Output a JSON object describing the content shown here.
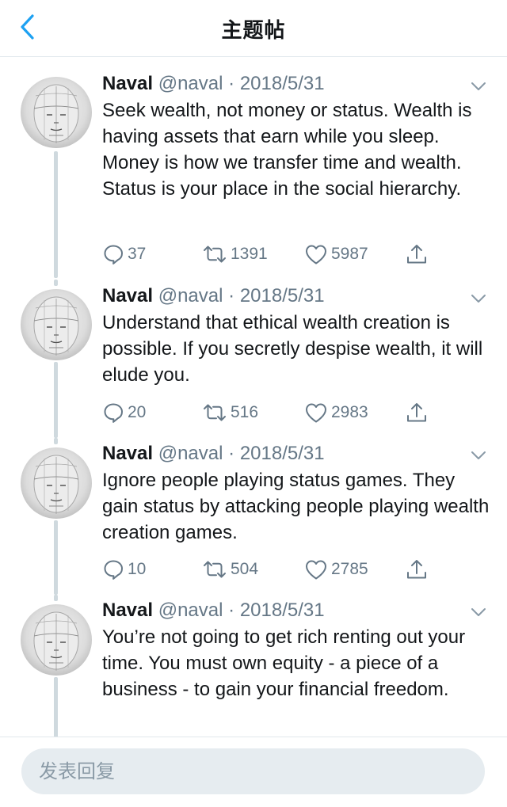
{
  "nav": {
    "title": "主题帖"
  },
  "tweets": [
    {
      "name": "Naval",
      "handle": "@naval",
      "separator": "·",
      "date": "2018/5/31",
      "text": "Seek wealth, not money or status. Wealth is having assets that earn while you sleep. Money is how we transfer time and wealth. Status is your place in the social hierarchy.",
      "replies": "37",
      "retweets": "1391",
      "likes": "5987"
    },
    {
      "name": "Naval",
      "handle": "@naval",
      "separator": "·",
      "date": "2018/5/31",
      "text": "Understand that ethical wealth creation is possible. If you secretly despise wealth, it will elude you.",
      "replies": "20",
      "retweets": "516",
      "likes": "2983"
    },
    {
      "name": "Naval",
      "handle": "@naval",
      "separator": "·",
      "date": "2018/5/31",
      "text": "Ignore people playing status games. They gain status by attacking people playing wealth creation games.",
      "replies": "10",
      "retweets": "504",
      "likes": "2785"
    },
    {
      "name": "Naval",
      "handle": "@naval",
      "separator": "·",
      "date": "2018/5/31",
      "text": "You’re not going to get rich renting out your time. You must own equity - a piece of a business - to gain your financial freedom."
    }
  ],
  "reply": {
    "placeholder": "发表回复"
  },
  "icons": {
    "back": "chevron-left-icon",
    "caret": "chevron-down-icon",
    "reply": "comment-icon",
    "retweet": "retweet-icon",
    "like": "heart-icon",
    "share": "share-icon"
  },
  "colors": {
    "accent": "#1da1f2",
    "muted": "#657786",
    "text": "#14171a",
    "divider": "#e1e8ed"
  }
}
